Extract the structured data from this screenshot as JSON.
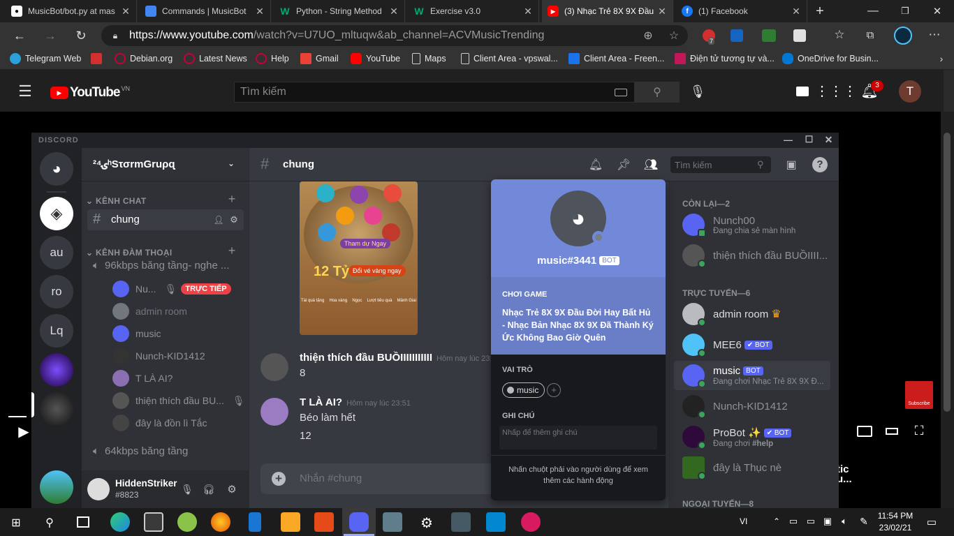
{
  "browser": {
    "tabs": [
      {
        "title": "MusicBot/bot.py at mas",
        "color": "#ffffff"
      },
      {
        "title": "Commands | MusicBot",
        "color": "#4285f4"
      },
      {
        "title": "Python - String Method",
        "color": "#04aa6d"
      },
      {
        "title": "Exercise v3.0",
        "color": "#04aa6d"
      },
      {
        "title": "(3) Nhạc Trẻ 8X 9X Đầu",
        "color": "#ff0000"
      },
      {
        "title": "(1) Facebook",
        "color": "#1877f2"
      }
    ],
    "url_domain": "https://www.youtube.com",
    "url_rest": "/watch?v=U7UO_mltuqw&ab_channel=ACVMusicTrending",
    "extension_badge": "7",
    "bookmarks": [
      "Telegram Web",
      "Debian.org",
      "Latest News",
      "Help",
      "Gmail",
      "YouTube",
      "Maps",
      "Client Area - vpswal...",
      "Client Area - Freen...",
      "Điện tử tương tự và...",
      "OneDrive for Busin..."
    ]
  },
  "youtube": {
    "logo": "YouTube",
    "region": "VN",
    "search_placeholder": "Tìm kiếm",
    "notifications": "3",
    "avatar_letter": "T",
    "subscribe_label": "Subscribe",
    "side_text_1": "tic",
    "side_text_2": "u..."
  },
  "discord": {
    "app_title": "DISCORD",
    "guild_icons": [
      "au",
      "ro",
      "Lq"
    ],
    "server_name": "ۍ²⁴ʰSτσrmGruρɋ",
    "categories": {
      "text": "KÊNH CHAT",
      "voice": "KÊNH ĐÀM THOẠI"
    },
    "text_channel": "chung",
    "voice_channel_1": "96kbps băng tầng- nghe ...",
    "voice_channel_2": "64kbps băng tầng",
    "voice_users": [
      {
        "name": "Nu...",
        "live": "TRỰC TIẾP"
      },
      {
        "name": "admin room"
      },
      {
        "name": "music"
      },
      {
        "name": "Nunch-KID1412"
      },
      {
        "name": "T LÀ AI?"
      },
      {
        "name": "thiện thích đầu BU..."
      },
      {
        "name": "đây là đồn lì Tắc"
      }
    ],
    "user": {
      "name": "HiddenStriker",
      "tag": "#8823"
    },
    "header": {
      "channel": "chung",
      "search_placeholder": "Tìm kiếm"
    },
    "embed_image": {
      "banner": "Tham dự Ngay",
      "amount": "12 Tỷ",
      "cta": "Đổi vé vàng ngay",
      "labels": [
        "Tài quà tặng",
        "Hoa vàng",
        "Ngọc",
        "Lượt tiêu quà",
        "Mảnh Giai"
      ]
    },
    "messages": [
      {
        "author": "thiện thích đầu BUỒIIIIIIIIIII",
        "time": "Hôm nay lúc 23:",
        "lines": [
          "8"
        ]
      },
      {
        "author": "T LÀ AI?",
        "time": "Hôm nay lúc 23:51",
        "lines": [
          "Béo làm hết",
          "12"
        ]
      }
    ],
    "composer_placeholder": "Nhắn #chung",
    "members": {
      "cat_rest": "CÒN LẠI—2",
      "cat_online": "TRỰC TUYẾN—6",
      "cat_offline": "NGOẠI TUYẾN—8",
      "rest": [
        {
          "name": "Nunch00",
          "status": "Đang chia sẻ màn hình"
        },
        {
          "name": "thiện thích đầu BUỒIIII..."
        }
      ],
      "online": [
        {
          "name": "admin room",
          "crown": "♛"
        },
        {
          "name": "MEE6",
          "bot": "✔ BOT"
        },
        {
          "name": "music",
          "bot": "BOT",
          "status": "Đang chơi Nhạc Trẻ 8X 9X Đ..."
        },
        {
          "name": "Nunch-KID1412"
        },
        {
          "name": "ProBot ✨",
          "bot": "✔ BOT",
          "status_prefix": "Đang chơi ",
          "status_bold": "#help"
        },
        {
          "name": "đây là Thục nè"
        }
      ]
    },
    "profile": {
      "username": "music#3441",
      "bot_tag": "BOT",
      "playing_label": "CHƠI GAME",
      "game_title": "Nhạc Trẻ 8X 9X Đầu Đời Hay Bất Hủ - Nhạc Bản Nhạc 8X 9X Đã Thành Ký Ức Không Bao Giờ Quên",
      "roles_label": "VAI TRÒ",
      "role": "music",
      "note_label": "GHI CHÚ",
      "note_placeholder": "Nhấp để thêm ghi chú",
      "footer": "Nhấn chuột phải vào người dùng để xem thêm các hành động"
    }
  },
  "taskbar": {
    "lang": "VI",
    "time": "11:54 PM",
    "date": "23/02/21"
  }
}
